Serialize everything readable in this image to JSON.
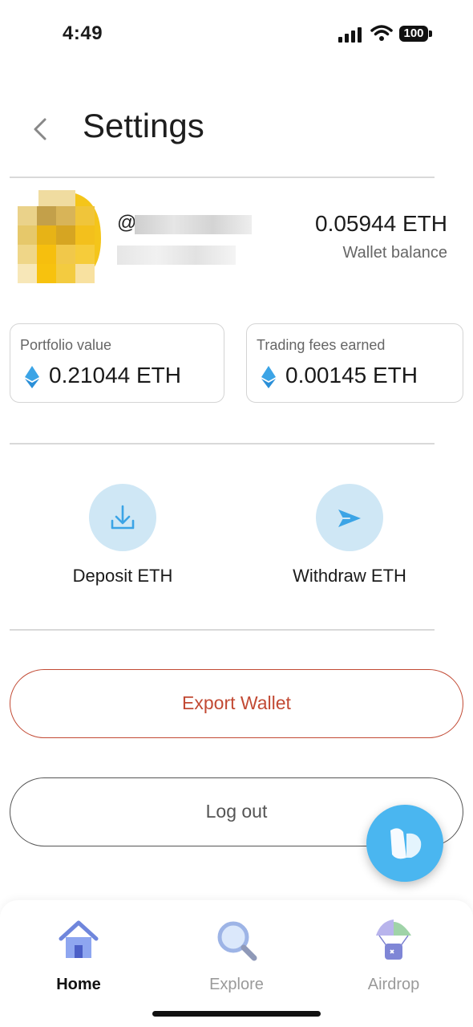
{
  "status_bar": {
    "time": "4:49",
    "battery": "100"
  },
  "header": {
    "title": "Settings",
    "back_icon": "chevron-left-icon"
  },
  "profile": {
    "handle_prefix": "@",
    "wallet_balance": "0.05944 ETH",
    "wallet_balance_label": "Wallet balance"
  },
  "stats": {
    "portfolio_label": "Portfolio value",
    "portfolio_value": "0.21044 ETH",
    "fees_label": "Trading fees earned",
    "fees_value": "0.00145 ETH"
  },
  "actions": {
    "deposit_label": "Deposit ETH",
    "withdraw_label": "Withdraw ETH"
  },
  "buttons": {
    "export_label": "Export Wallet",
    "logout_label": "Log out"
  },
  "tabs": [
    {
      "label": "Home",
      "icon": "home-icon",
      "active": true
    },
    {
      "label": "Explore",
      "icon": "search-icon",
      "active": false
    },
    {
      "label": "Airdrop",
      "icon": "airdrop-icon",
      "active": false
    }
  ],
  "colors": {
    "accent_red": "#c24a34",
    "action_bg": "#cfe7f5",
    "icon_blue": "#3ba4e6",
    "fab_blue": "#4ab6f0"
  }
}
